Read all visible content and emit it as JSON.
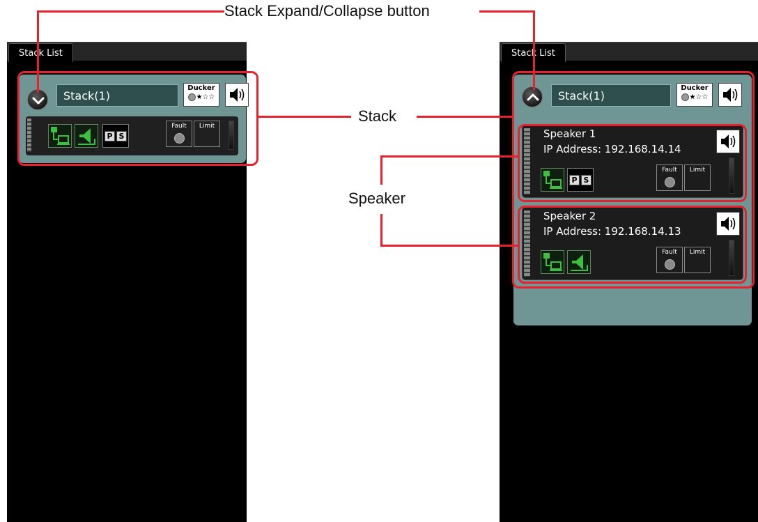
{
  "callouts": {
    "expand_collapse": "Stack Expand/Collapse button",
    "stack": "Stack",
    "speaker": "Speaker"
  },
  "left_panel": {
    "tab": "Stack List",
    "stack": {
      "name": "Stack(1)",
      "state": "collapsed",
      "ducker": {
        "label": "Ducker",
        "stars_filled": 1,
        "stars_total": 3
      },
      "fault_label": "Fault",
      "limit_label": "Limit",
      "ps": [
        "P",
        "S"
      ]
    }
  },
  "right_panel": {
    "tab": "Stack List",
    "stack": {
      "name": "Stack(1)",
      "state": "expanded",
      "ducker": {
        "label": "Ducker",
        "stars_filled": 1,
        "stars_total": 3
      }
    },
    "speakers": [
      {
        "name": "Speaker 1",
        "ip": "IP Address: 192.168.14.14",
        "fault_label": "Fault",
        "limit_label": "Limit",
        "ps": [
          "P",
          "S"
        ]
      },
      {
        "name": "Speaker 2",
        "ip": "IP Address: 192.168.14.13",
        "fault_label": "Fault",
        "limit_label": "Limit"
      }
    ]
  },
  "colors": {
    "highlight": "#e8222c",
    "stack_bg": "#6f9594",
    "name_box": "#2e4f4e",
    "icon_green": "#3fbf3f"
  },
  "icons": [
    "chevron-down-icon",
    "chevron-up-icon",
    "speaker-volume-icon",
    "network-link-icon",
    "speaker-output-icon",
    "star-icon"
  ]
}
